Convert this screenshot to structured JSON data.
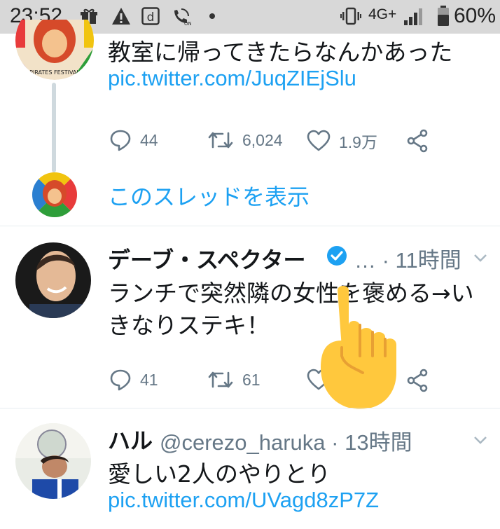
{
  "status_bar": {
    "time": "23:52",
    "network": "4G+",
    "battery": "60%",
    "icons": [
      "gift-icon",
      "warning-icon",
      "d-app-icon",
      "wifi-calling-icon",
      "notification-dot-icon",
      "vibrate-icon",
      "signal-icon",
      "battery-icon"
    ]
  },
  "tweets": [
    {
      "text": "教室に帰ってきたらなんかあった",
      "link": "pic.twitter.com/JuqZIEjSlu",
      "replies": "44",
      "retweets": "6,024",
      "likes": "1.9万"
    },
    {
      "show_thread": "このスレッドを表示"
    },
    {
      "name": "デーブ・スペクター",
      "verified": true,
      "time": "… · 11時間",
      "text_line1": "ランチで突然隣の女性を褒める→い",
      "text_line2": "きなりステキ！",
      "replies": "41",
      "retweets": "61"
    },
    {
      "name": "ハル",
      "handle": "@cerezo_haruka · 13時間",
      "text": "愛しい2人のやりとり",
      "link": "pic.twitter.com/UVagd8zP7Z"
    }
  ],
  "colors": {
    "accent": "#1da1f2",
    "muted": "#657786",
    "status_bar": "#d8d8d8",
    "emoji_hand": "#ffc83d"
  }
}
